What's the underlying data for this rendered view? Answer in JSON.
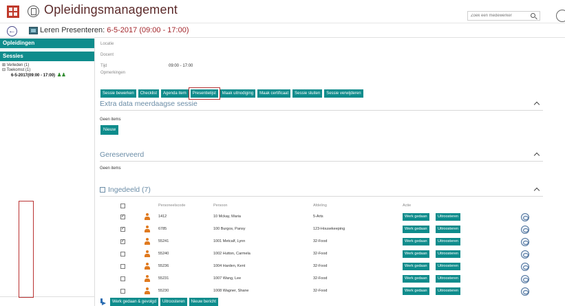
{
  "header": {
    "title": "Opleidingsmanagement",
    "search_placeholder": "Zoek een medewerker"
  },
  "subheader": {
    "prefix": "Leren Presenteren: ",
    "date_time": "6-5-2017 (09:00 - 17:00)"
  },
  "sidebar": {
    "opleidingen_label": "Opleidingen",
    "sessies_label": "Sessies",
    "tree": {
      "verleden": "⊞ Verleden (1)",
      "toekomst": "⊟ Toekomst (1)",
      "active": "6-5-2017(09:00 - 17:00)"
    }
  },
  "details": {
    "locatie_label": "Locatie",
    "docent_label": "Docent",
    "tijd_label": "Tijd",
    "tijd_value": "09:00 - 17:00",
    "opmerkingen_label": "Opmerkingen"
  },
  "toolbar": {
    "buttons": [
      "Sessie bewerken",
      "Checklist",
      "Agenda item",
      "Presentielijst",
      "Maak uitnodiging",
      "Maak certificaat",
      "Sessie sluiten",
      "Sessie verwijderen"
    ]
  },
  "sections": {
    "extra": {
      "title": "Extra data meerdaagse sessie",
      "empty": "Geen items",
      "new_button": "Nieuw"
    },
    "gereserveerd": {
      "title": "Gereserveerd",
      "empty": "Geen items"
    },
    "ingedeeld": {
      "title": "Ingedeeld (7)"
    }
  },
  "table": {
    "headers": {
      "code": "Personeelscode",
      "person": "Persoon",
      "dept": "Afdeling",
      "action": "Actie"
    },
    "rows": [
      {
        "checked": true,
        "code": "1412",
        "person": "10 Mckay, Maria",
        "dept": "5-Arts"
      },
      {
        "checked": true,
        "code": "6785",
        "person": "100 Burgos, Pansy",
        "dept": "123-Housekeeping"
      },
      {
        "checked": true,
        "code": "55241",
        "person": "1001 Metcalf, Lynn",
        "dept": "32-Food"
      },
      {
        "checked": false,
        "code": "55240",
        "person": "1002 Hutton, Carmela",
        "dept": "32-Food"
      },
      {
        "checked": false,
        "code": "55236",
        "person": "1004 Harden, Kent",
        "dept": "32-Food"
      },
      {
        "checked": false,
        "code": "55231",
        "person": "1007 Wang, Lee",
        "dept": "32-Food"
      },
      {
        "checked": false,
        "code": "55230",
        "person": "1008 Wagner, Shane",
        "dept": "32-Food"
      }
    ],
    "row_actions": {
      "done": "Werk gedaan",
      "unschedule": "Uitroosteren"
    }
  },
  "bottom_actions": {
    "done_followed": "Werk gedaan & gevolgd",
    "unschedule": "Uitroosteren",
    "new_message": "Nieuw bericht"
  },
  "colors": {
    "accent": "#0e8c8c",
    "highlight": "#b93232",
    "title": "#5b2a2a"
  }
}
